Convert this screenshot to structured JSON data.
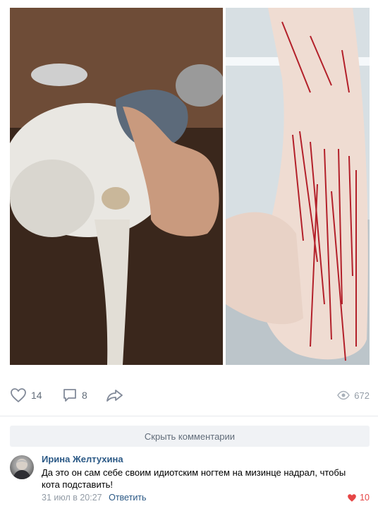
{
  "post": {
    "photos": [
      {
        "description_icon": "cat-photo-icon",
        "bg": "#5a3d2c"
      },
      {
        "description_icon": "scratched-arm-photo-icon",
        "bg": "#cfd8dc"
      }
    ],
    "actions": {
      "likes": "14",
      "comments": "8",
      "views": "672"
    }
  },
  "comments_section": {
    "hide_label": "Скрыть комментарии",
    "comment": {
      "author": "Ирина Желтухина",
      "text": "Да это он сам себе своим идиотским ногтем на мизинце надрал, чтобы кота подставить!",
      "date": "31 июл в 20:27",
      "reply_label": "Ответить",
      "likes": "10"
    }
  },
  "colors": {
    "accent": "#2a5885",
    "muted": "#626d7a",
    "like_active": "#e64646"
  }
}
